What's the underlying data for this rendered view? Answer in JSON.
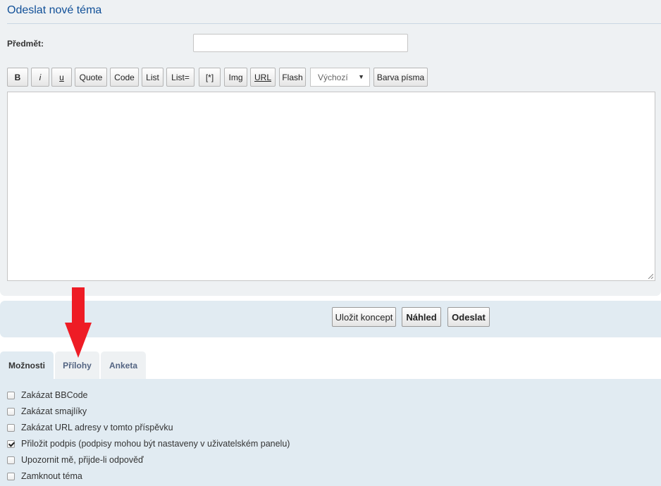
{
  "page": {
    "title": "Odeslat nové téma"
  },
  "subject": {
    "label": "Předmět:",
    "value": ""
  },
  "toolbar": {
    "buttons": [
      "B",
      "i",
      "u",
      "Quote",
      "Code",
      "List",
      "List=",
      "[*]",
      "Img",
      "URL",
      "Flash"
    ],
    "font_size_select": "Výchozí",
    "color_button": "Barva písma"
  },
  "editor": {
    "value": ""
  },
  "actions": {
    "save_draft": "Uložit koncept",
    "preview": "Náhled",
    "submit": "Odeslat"
  },
  "tabs": [
    {
      "label": "Možnosti",
      "active": true
    },
    {
      "label": "Přílohy",
      "active": false
    },
    {
      "label": "Anketa",
      "active": false
    }
  ],
  "options": [
    {
      "label": "Zakázat BBCode",
      "checked": false
    },
    {
      "label": "Zakázat smajlíky",
      "checked": false
    },
    {
      "label": "Zakázat URL adresy v tomto příspěvku",
      "checked": false
    },
    {
      "label": "Přiložit podpis (podpisy mohou být nastaveny v uživatelském panelu)",
      "checked": true
    },
    {
      "label": "Upozornit mě, přijde-li odpověď",
      "checked": false
    },
    {
      "label": "Zamknout téma",
      "checked": false
    }
  ],
  "annotation": {
    "icon": "red-down-arrow-icon",
    "color": "#ee1c25"
  },
  "colors": {
    "title": "#115098",
    "panel": "#e1ebf2",
    "panel_light": "#eef1f3",
    "tab_inactive_text": "#536482"
  }
}
